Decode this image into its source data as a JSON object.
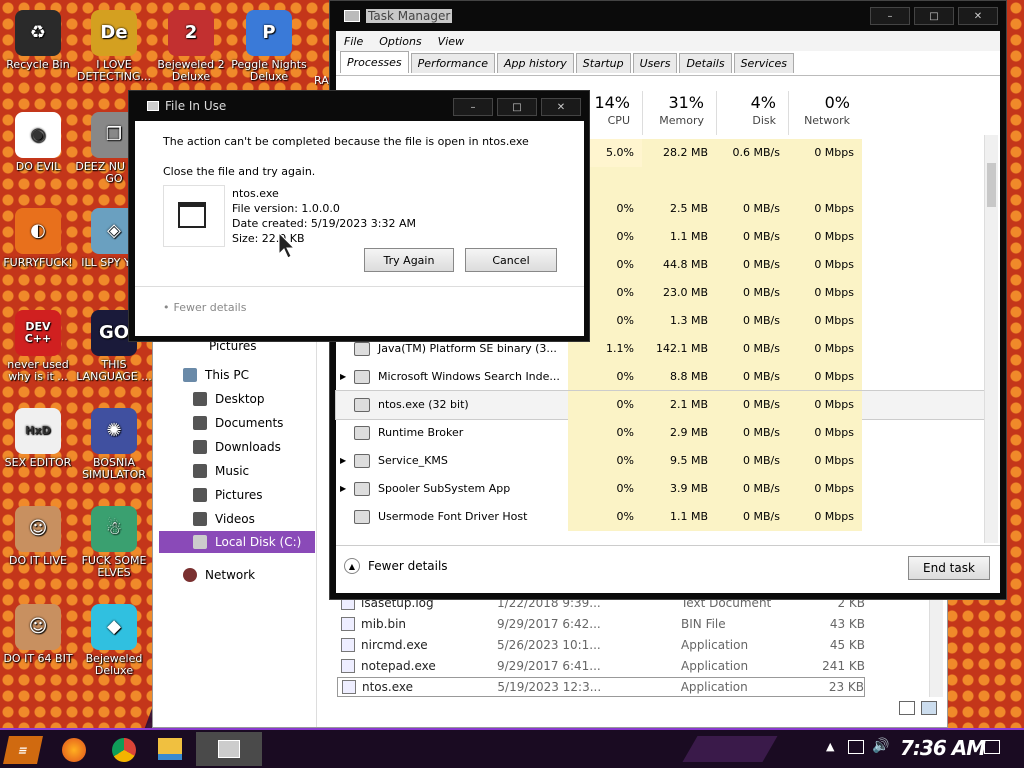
{
  "desktop": {
    "icons": [
      {
        "label": "Recycle Bin",
        "color": "#2a2a2a",
        "glyph": "♻"
      },
      {
        "label": "I LOVE DETECTING...",
        "color": "#d4a020",
        "glyph": "De"
      },
      {
        "label": "Bejeweled 2 Deluxe",
        "color": "#c23030",
        "glyph": "2"
      },
      {
        "label": "Peggle Nights Deluxe",
        "color": "#3a7ad8",
        "glyph": "P"
      },
      {
        "label": "DO EVIL",
        "color": "#ffffff",
        "glyph": "◉"
      },
      {
        "label": "DEEZ NU HAH GO",
        "color": "#888888",
        "glyph": "❐"
      },
      {
        "label": "FURRYFUCK!",
        "color": "#e8701c",
        "glyph": "◐"
      },
      {
        "label": "ILL SPY YOU",
        "color": "#6aa0c0",
        "glyph": "◈"
      },
      {
        "label": "never used why is it ...",
        "color": "#d02020",
        "glyph": "DEV C++"
      },
      {
        "label": "THIS LANGUAGE ...",
        "color": "#1a1a3a",
        "glyph": "GO"
      },
      {
        "label": "SEX EDITOR",
        "color": "#f0f0f0",
        "glyph": "HxD"
      },
      {
        "label": "BOSNIA SIMULATOR",
        "color": "#4050a0",
        "glyph": "✺"
      },
      {
        "label": "DO IT LIVE",
        "color": "#c89060",
        "glyph": "☺"
      },
      {
        "label": "FUCK SOME ELVES",
        "color": "#3aa070",
        "glyph": "☃"
      },
      {
        "label": "DO IT 64 BIT",
        "color": "#c89060",
        "glyph": "☺"
      },
      {
        "label": "Bejeweled Deluxe",
        "color": "#30c0e0",
        "glyph": "◆"
      }
    ],
    "partial_label": "RA"
  },
  "explorer": {
    "nav": {
      "pictures_top": "Pictures",
      "this_pc": "This PC",
      "desktop": "Desktop",
      "documents": "Documents",
      "downloads": "Downloads",
      "music": "Music",
      "pictures": "Pictures",
      "videos": "Videos",
      "local_disk": "Local Disk (C:)",
      "network": "Network"
    },
    "files": [
      {
        "name": "isasetup.log",
        "date": "1/22/2018 9:39...",
        "type": "Text Document",
        "size": "2 KB"
      },
      {
        "name": "mib.bin",
        "date": "9/29/2017 6:42...",
        "type": "BIN File",
        "size": "43 KB"
      },
      {
        "name": "nircmd.exe",
        "date": "5/26/2023 10:1...",
        "type": "Application",
        "size": "45 KB"
      },
      {
        "name": "notepad.exe",
        "date": "9/29/2017 6:41...",
        "type": "Application",
        "size": "241 KB"
      },
      {
        "name": "ntos.exe",
        "date": "5/19/2023 12:3...",
        "type": "Application",
        "size": "23 KB"
      }
    ]
  },
  "taskmanager": {
    "title": "Task Manager",
    "menu": [
      "File",
      "Options",
      "View"
    ],
    "tabs": [
      "Processes",
      "Performance",
      "App history",
      "Startup",
      "Users",
      "Details",
      "Services"
    ],
    "columns": [
      {
        "pct": "14%",
        "label": "CPU"
      },
      {
        "pct": "31%",
        "label": "Memory"
      },
      {
        "pct": "4%",
        "label": "Disk"
      },
      {
        "pct": "0%",
        "label": "Network"
      }
    ],
    "rows": [
      {
        "name": "",
        "cpu": "5.0%",
        "mem": "28.2 MB",
        "disk": "0.6 MB/s",
        "net": "0 Mbps"
      },
      {
        "name": "",
        "cpu": "",
        "mem": "",
        "disk": "",
        "net": ""
      },
      {
        "name": "",
        "cpu": "0%",
        "mem": "2.5 MB",
        "disk": "0 MB/s",
        "net": "0 Mbps"
      },
      {
        "name": "",
        "cpu": "0%",
        "mem": "1.1 MB",
        "disk": "0 MB/s",
        "net": "0 Mbps"
      },
      {
        "name": "",
        "cpu": "0%",
        "mem": "44.8 MB",
        "disk": "0 MB/s",
        "net": "0 Mbps"
      },
      {
        "name": "",
        "cpu": "0%",
        "mem": "23.0 MB",
        "disk": "0 MB/s",
        "net": "0 Mbps"
      },
      {
        "name": "",
        "cpu": "0%",
        "mem": "1.3 MB",
        "disk": "0 MB/s",
        "net": "0 Mbps"
      },
      {
        "name": "Java(TM) Platform SE binary (3...",
        "cpu": "1.1%",
        "mem": "142.1 MB",
        "disk": "0 MB/s",
        "net": "0 Mbps"
      },
      {
        "name": "Microsoft Windows Search Inde...",
        "cpu": "0%",
        "mem": "8.8 MB",
        "disk": "0 MB/s",
        "net": "0 Mbps",
        "expand": true
      },
      {
        "name": "ntos.exe (32 bit)",
        "cpu": "0%",
        "mem": "2.1 MB",
        "disk": "0 MB/s",
        "net": "0 Mbps",
        "selected": true
      },
      {
        "name": "Runtime Broker",
        "cpu": "0%",
        "mem": "2.9 MB",
        "disk": "0 MB/s",
        "net": "0 Mbps"
      },
      {
        "name": "Service_KMS",
        "cpu": "0%",
        "mem": "9.5 MB",
        "disk": "0 MB/s",
        "net": "0 Mbps",
        "expand": true
      },
      {
        "name": "Spooler SubSystem App",
        "cpu": "0%",
        "mem": "3.9 MB",
        "disk": "0 MB/s",
        "net": "0 Mbps",
        "expand": true
      },
      {
        "name": "Usermode Font Driver Host",
        "cpu": "0%",
        "mem": "1.1 MB",
        "disk": "0 MB/s",
        "net": "0 Mbps"
      }
    ],
    "fewer_details": "Fewer details",
    "end_task": "End task"
  },
  "dialog": {
    "title": "File In Use",
    "message": "The action can't be completed because the file is open in ntos.exe",
    "instruction": "Close the file and try again.",
    "file_name": "ntos.exe",
    "file_version": "File version: 1.0.0.0",
    "date_created": "Date created: 5/19/2023 3:32 AM",
    "size": "Size: 22.0 KB",
    "try_again": "Try Again",
    "cancel": "Cancel",
    "fewer_details": "Fewer details"
  },
  "taskbar": {
    "clock": "7:36 AM"
  },
  "colors": {
    "accent_purple": "#8a4ab8",
    "desktop_orange": "#c4361a",
    "highlight_yellow": "#fbf3c6"
  }
}
